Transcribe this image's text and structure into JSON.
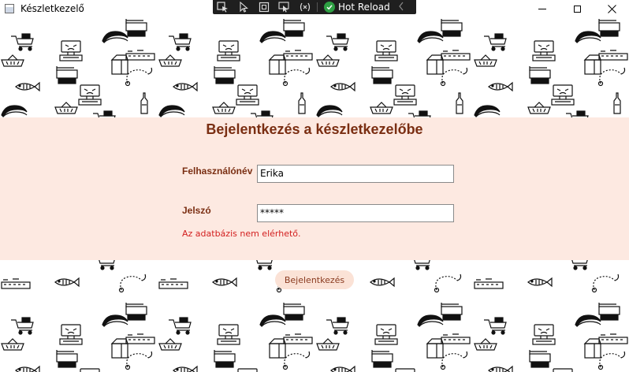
{
  "window": {
    "title": "Készletkezelő"
  },
  "debug_toolbar": {
    "hot_reload_label": "Hot Reload",
    "icons": [
      "select-element-icon",
      "pointer-icon",
      "layout-adorner-icon",
      "track-focus-icon",
      "binding-failures-icon",
      "hot-reload-check-icon",
      "collapse-chevron-icon"
    ]
  },
  "login": {
    "heading": "Bejelentkezés a készletkezelőbe",
    "username_label": "Felhasználónév",
    "username_value": "Erika",
    "password_label": "Jelszó",
    "password_value": "*****",
    "error_message": "Az adatbázis nem elérhető.",
    "submit_label": "Bejelentkezés"
  },
  "colors": {
    "panel_background": "#fde9e1",
    "heading_color": "#7a2e12",
    "error_color": "#d32020",
    "button_background": "#fbe2d6"
  },
  "background_pattern": {
    "icons": [
      "cart-icon",
      "scale-icon",
      "sausage-icon",
      "cash-register-icon",
      "shelf-icon",
      "fish-icon",
      "basket-icon",
      "milk-carton-icon",
      "bottle-icon",
      "necklace-icon"
    ]
  }
}
